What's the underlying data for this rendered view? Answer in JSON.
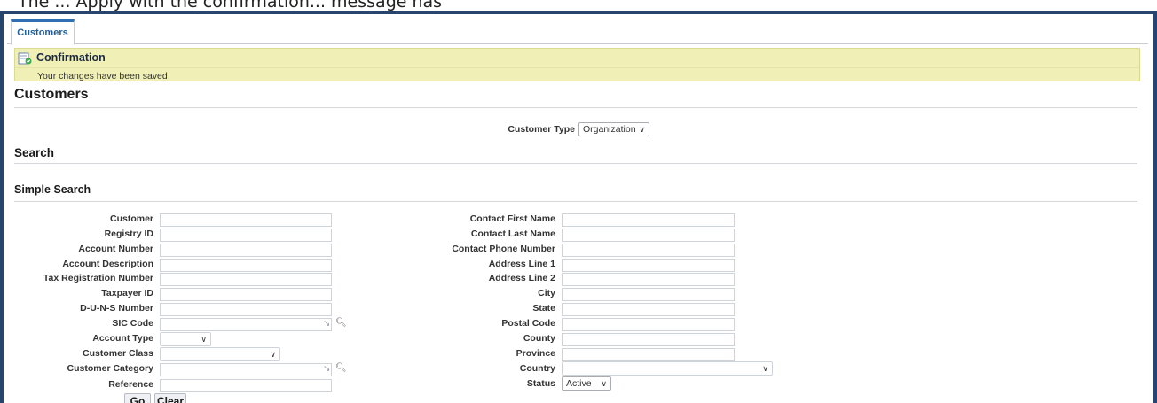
{
  "caption": "The ... Apply with the confirmation... message has",
  "tabs": [
    {
      "label": "Customers",
      "active": true
    }
  ],
  "confirmation": {
    "title": "Confirmation",
    "message": "Your changes have been saved"
  },
  "page_title": "Customers",
  "customer_type": {
    "label": "Customer Type",
    "value": "Organization"
  },
  "search": {
    "title": "Search",
    "subtitle": "Simple Search"
  },
  "left_fields": [
    {
      "label": "Customer",
      "value": ""
    },
    {
      "label": "Registry ID",
      "value": ""
    },
    {
      "label": "Account Number",
      "value": ""
    },
    {
      "label": "Account Description",
      "value": ""
    },
    {
      "label": "Tax Registration Number",
      "value": ""
    },
    {
      "label": "Taxpayer ID",
      "value": ""
    },
    {
      "label": "D-U-N-S Number",
      "value": ""
    },
    {
      "label": "SIC Code",
      "value": ""
    },
    {
      "label": "Account Type",
      "value": ""
    },
    {
      "label": "Customer Class",
      "value": ""
    },
    {
      "label": "Customer Category",
      "value": ""
    },
    {
      "label": "Reference",
      "value": ""
    }
  ],
  "right_fields": [
    {
      "label": "Contact First Name",
      "value": ""
    },
    {
      "label": "Contact Last Name",
      "value": ""
    },
    {
      "label": "Contact Phone Number",
      "value": ""
    },
    {
      "label": "Address Line 1",
      "value": ""
    },
    {
      "label": "Address Line 2",
      "value": ""
    },
    {
      "label": "City",
      "value": ""
    },
    {
      "label": "State",
      "value": ""
    },
    {
      "label": "Postal Code",
      "value": ""
    },
    {
      "label": "County",
      "value": ""
    },
    {
      "label": "Province",
      "value": ""
    },
    {
      "label": "Country",
      "value": ""
    },
    {
      "label": "Status",
      "value": "Active"
    }
  ],
  "buttons": {
    "go": "Go",
    "clear": "Clear"
  },
  "colors": {
    "frame": "#26466d",
    "confirm_bg": "#f0f0b6",
    "tab_accent": "#2f6fb3"
  }
}
